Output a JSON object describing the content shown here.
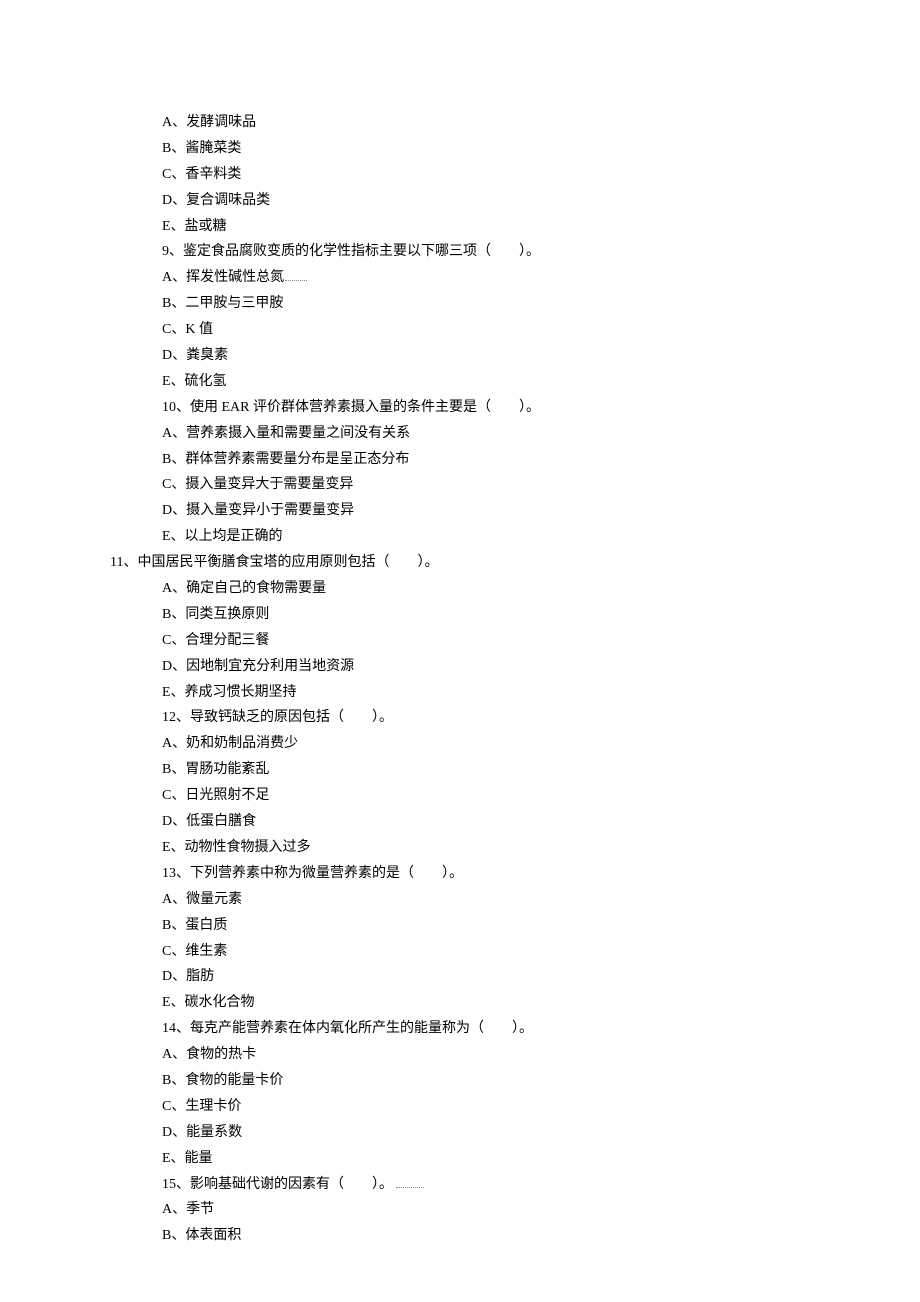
{
  "lines": {
    "l01": "A、发酵调味品",
    "l02": "B、酱腌菜类",
    "l03": "C、香辛料类",
    "l04": "D、复合调味品类",
    "l05": "E、盐或糖",
    "l06": "9、鉴定食品腐败变质的化学性指标主要以下哪三项（　　）。",
    "l07": "A、挥发性碱性总氮",
    "l08": "B、二甲胺与三甲胺",
    "l09": "C、K 值",
    "l10": "D、粪臭素",
    "l11": "E、硫化氢",
    "l12": "10、使用 EAR 评价群体营养素摄入量的条件主要是（　　）。",
    "l13": "A、营养素摄入量和需要量之间没有关系",
    "l14": "B、群体营养素需要量分布是呈正态分布",
    "l15": "C、摄入量变异大于需要量变异",
    "l16": "D、摄入量变异小于需要量变异",
    "l17": "E、以上均是正确的",
    "l18": "11、中国居民平衡膳食宝塔的应用原则包括（　　）。",
    "l19": "A、确定自己的食物需要量",
    "l20": "B、同类互换原则",
    "l21": "C、合理分配三餐",
    "l22": "D、因地制宜充分利用当地资源",
    "l23": "E、养成习惯长期坚持",
    "l24": "12、导致钙缺乏的原因包括（　　）。",
    "l25": "A、奶和奶制品消费少",
    "l26": "B、胃肠功能紊乱",
    "l27": "C、日光照射不足",
    "l28": "D、低蛋白膳食",
    "l29": "E、动物性食物摄入过多",
    "l30": "13、下列营养素中称为微量营养素的是（　　）。",
    "l31": "A、微量元素",
    "l32": "B、蛋白质",
    "l33": "C、维生素",
    "l34": "D、脂肪",
    "l35": "E、碳水化合物",
    "l36": "14、每克产能营养素在体内氧化所产生的能量称为（　　）。",
    "l37": "A、食物的热卡",
    "l38": "B、食物的能量卡价",
    "l39": "C、生理卡价",
    "l40": "D、能量系数",
    "l41": "E、能量",
    "l42": "15、影响基础代谢的因素有（　　）。",
    "l43": "A、季节",
    "l44": "B、体表面积"
  }
}
